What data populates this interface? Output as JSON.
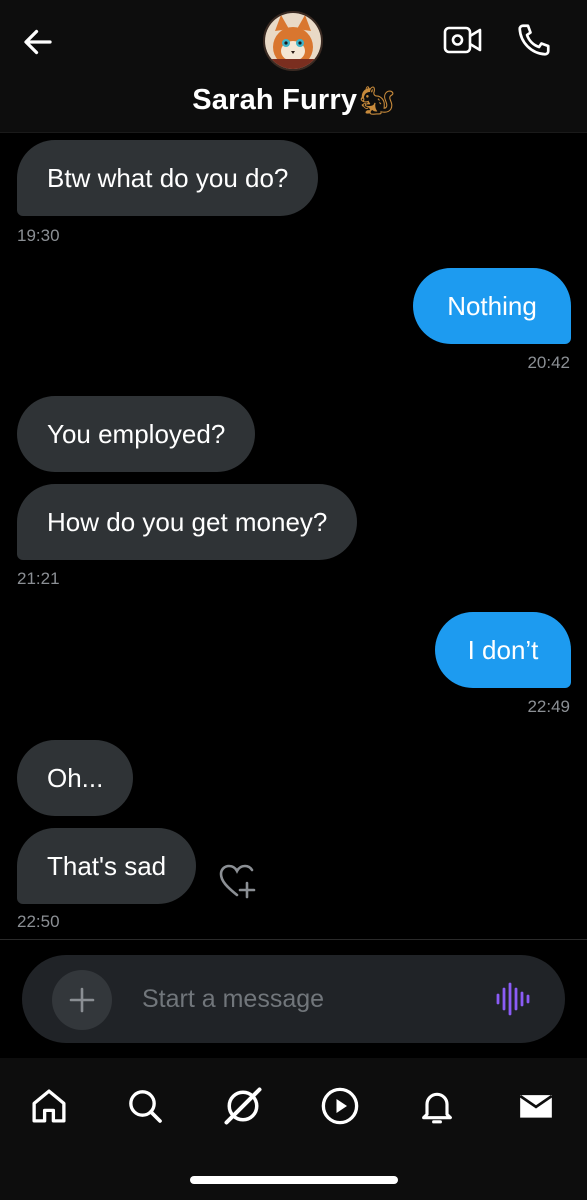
{
  "header": {
    "contact_name": "Sarah Furry",
    "contact_emoji": "🐿",
    "back_icon": "arrow-left-icon",
    "video_icon": "video-camera-icon",
    "call_icon": "phone-icon"
  },
  "messages": [
    {
      "direction": "in",
      "text": "Btw what do you do?"
    },
    {
      "direction": "out",
      "text": "Nothing"
    },
    {
      "direction": "in",
      "text": "You employed?"
    },
    {
      "direction": "in",
      "text": "How do you get money?"
    },
    {
      "direction": "out",
      "text": "I don’t"
    },
    {
      "direction": "in",
      "text": "Oh..."
    },
    {
      "direction": "in",
      "text": "That's sad"
    }
  ],
  "timestamps": [
    "19:30",
    "20:42",
    "21:21",
    "22:49",
    "22:50"
  ],
  "composer": {
    "placeholder": "Start a message",
    "plus_icon": "plus-icon",
    "voice_icon": "voice-waveform-icon"
  },
  "tabs": [
    {
      "icon": "home-icon"
    },
    {
      "icon": "search-icon"
    },
    {
      "icon": "grok-icon"
    },
    {
      "icon": "play-icon"
    },
    {
      "icon": "bell-icon"
    },
    {
      "icon": "mail-icon",
      "active": true
    }
  ],
  "colors": {
    "background": "#000000",
    "incoming_bubble": "#2f3336",
    "outgoing_bubble": "#1d9bf0",
    "timestamp": "#8b8f94",
    "voice_accent": "#8b5cf6"
  }
}
